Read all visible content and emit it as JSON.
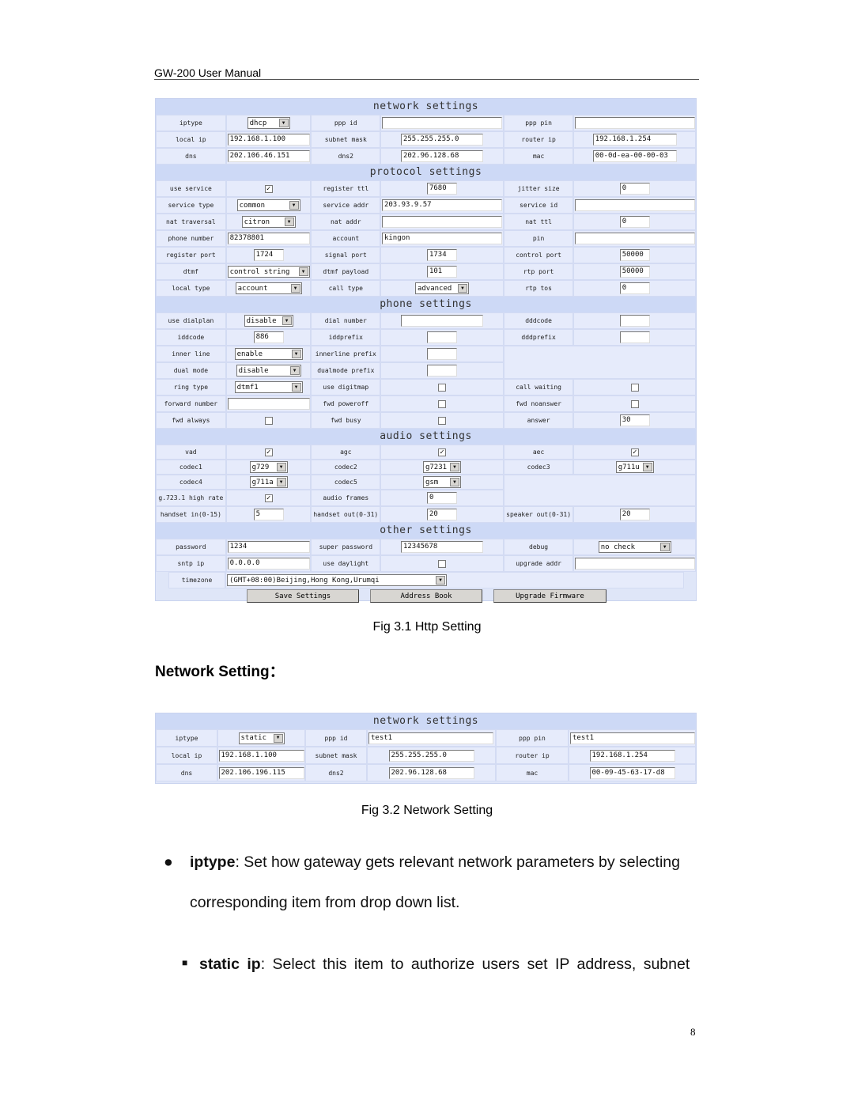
{
  "header": {
    "title": "GW-200 User Manual"
  },
  "fig1": {
    "network": {
      "title": "network settings",
      "iptype_label": "iptype",
      "iptype": "dhcp",
      "ppp_id_label": "ppp id",
      "ppp_id": "",
      "ppp_pin_label": "ppp pin",
      "ppp_pin": "",
      "local_ip_label": "local ip",
      "local_ip": "192.168.1.100",
      "subnet_mask_label": "subnet mask",
      "subnet_mask": "255.255.255.0",
      "router_ip_label": "router ip",
      "router_ip": "192.168.1.254",
      "dns_label": "dns",
      "dns": "202.106.46.151",
      "dns2_label": "dns2",
      "dns2": "202.96.128.68",
      "mac_label": "mac",
      "mac": "00-0d-ea-00-00-03"
    },
    "protocol": {
      "title": "protocol settings",
      "use_service_label": "use service",
      "use_service": true,
      "register_ttl_label": "register ttl",
      "register_ttl": "7680",
      "jitter_size_label": "jitter size",
      "jitter_size": "0",
      "service_type_label": "service type",
      "service_type": "common",
      "service_addr_label": "service addr",
      "service_addr": "203.93.9.57",
      "service_id_label": "service id",
      "service_id": "",
      "nat_traversal_label": "nat traversal",
      "nat_traversal": "citron",
      "nat_addr_label": "nat addr",
      "nat_addr": "",
      "nat_ttl_label": "nat ttl",
      "nat_ttl": "0",
      "phone_number_label": "phone number",
      "phone_number": "82378801",
      "account_label": "account",
      "account": "kingon",
      "pin_label": "pin",
      "pin": "",
      "register_port_label": "register port",
      "register_port": "1724",
      "signal_port_label": "signal port",
      "signal_port": "1734",
      "control_port_label": "control port",
      "control_port": "50000",
      "dtmf_label": "dtmf",
      "dtmf": "control string",
      "dtmf_payload_label": "dtmf payload",
      "dtmf_payload": "101",
      "rtp_port_label": "rtp port",
      "rtp_port": "50000",
      "local_type_label": "local type",
      "local_type": "account",
      "call_type_label": "call type",
      "call_type": "advanced",
      "rtp_tos_label": "rtp tos",
      "rtp_tos": "0"
    },
    "phone": {
      "title": "phone settings",
      "use_dialplan_label": "use dialplan",
      "use_dialplan": "disable",
      "dial_number_label": "dial number",
      "dial_number": "",
      "dddcode_label": "dddcode",
      "dddcode": "",
      "iddcode_label": "iddcode",
      "iddcode": "886",
      "iddprefix_label": "iddprefix",
      "iddprefix": "",
      "dddprefix_label": "dddprefix",
      "dddprefix": "",
      "inner_line_label": "inner line",
      "inner_line": "enable",
      "innerline_prefix_label": "innerline prefix",
      "innerline_prefix": "",
      "dual_mode_label": "dual mode",
      "dual_mode": "disable",
      "dualmode_prefix_label": "dualmode prefix",
      "dualmode_prefix": "",
      "ring_type_label": "ring type",
      "ring_type": "dtmf1",
      "use_digitmap_label": "use digitmap",
      "use_digitmap": false,
      "call_waiting_label": "call waiting",
      "call_waiting": false,
      "forward_number_label": "forward number",
      "forward_number": "",
      "fwd_poweroff_label": "fwd poweroff",
      "fwd_poweroff": false,
      "fwd_noanswer_label": "fwd noanswer",
      "fwd_noanswer": false,
      "fwd_always_label": "fwd always",
      "fwd_always": false,
      "fwd_busy_label": "fwd busy",
      "fwd_busy": false,
      "answer_label": "answer",
      "answer": "30"
    },
    "audio": {
      "title": "audio settings",
      "vad_label": "vad",
      "vad": true,
      "agc_label": "agc",
      "agc": true,
      "aec_label": "aec",
      "aec": true,
      "codec1_label": "codec1",
      "codec1": "g729",
      "codec2_label": "codec2",
      "codec2": "g7231",
      "codec3_label": "codec3",
      "codec3": "g711u",
      "codec4_label": "codec4",
      "codec4": "g711a",
      "codec5_label": "codec5",
      "codec5": "gsm",
      "g7231_high_rate_label": "g.723.1 high rate",
      "g7231_high_rate": true,
      "audio_frames_label": "audio frames",
      "audio_frames": "0",
      "handset_in_label": "handset in(0-15)",
      "handset_in": "5",
      "handset_out_label": "handset out(0-31)",
      "handset_out": "20",
      "speaker_out_label": "speaker out(0-31)",
      "speaker_out": "20"
    },
    "other": {
      "title": "other settings",
      "password_label": "password",
      "password": "1234",
      "super_password_label": "super password",
      "super_password": "12345678",
      "debug_label": "debug",
      "debug": "no check",
      "sntp_ip_label": "sntp ip",
      "sntp_ip": "0.0.0.0",
      "use_daylight_label": "use daylight",
      "use_daylight": false,
      "upgrade_addr_label": "upgrade addr",
      "upgrade_addr": "",
      "timezone_label": "timezone",
      "timezone": "(GMT+08:00)Beijing,Hong Kong,Urumqi"
    },
    "buttons": {
      "save": "Save Settings",
      "address_book": "Address Book",
      "upgrade": "Upgrade Firmware"
    },
    "caption": "Fig 3.1 Http Setting"
  },
  "section_heading": "Network Setting：",
  "fig2": {
    "title": "network settings",
    "iptype_label": "iptype",
    "iptype": "static",
    "ppp_id_label": "ppp id",
    "ppp_id": "test1",
    "ppp_pin_label": "ppp pin",
    "ppp_pin": "test1",
    "local_ip_label": "local ip",
    "local_ip": "192.168.1.100",
    "subnet_mask_label": "subnet mask",
    "subnet_mask": "255.255.255.0",
    "router_ip_label": "router ip",
    "router_ip": "192.168.1.254",
    "dns_label": "dns",
    "dns": "202.106.196.115",
    "dns2_label": "dns2",
    "dns2": "202.96.128.68",
    "mac_label": "mac",
    "mac": "00-09-45-63-17-d8",
    "caption": "Fig 3.2 Network Setting"
  },
  "body": {
    "bullet1_term": "iptype",
    "bullet1_text": ": Set how gateway gets relevant network parameters by selecting",
    "bullet1_cont": "corresponding item from drop down list.",
    "bullet2_term": "static ip",
    "bullet2_text": ": Select this item to authorize users set IP address, subnet"
  },
  "page_number": "8"
}
